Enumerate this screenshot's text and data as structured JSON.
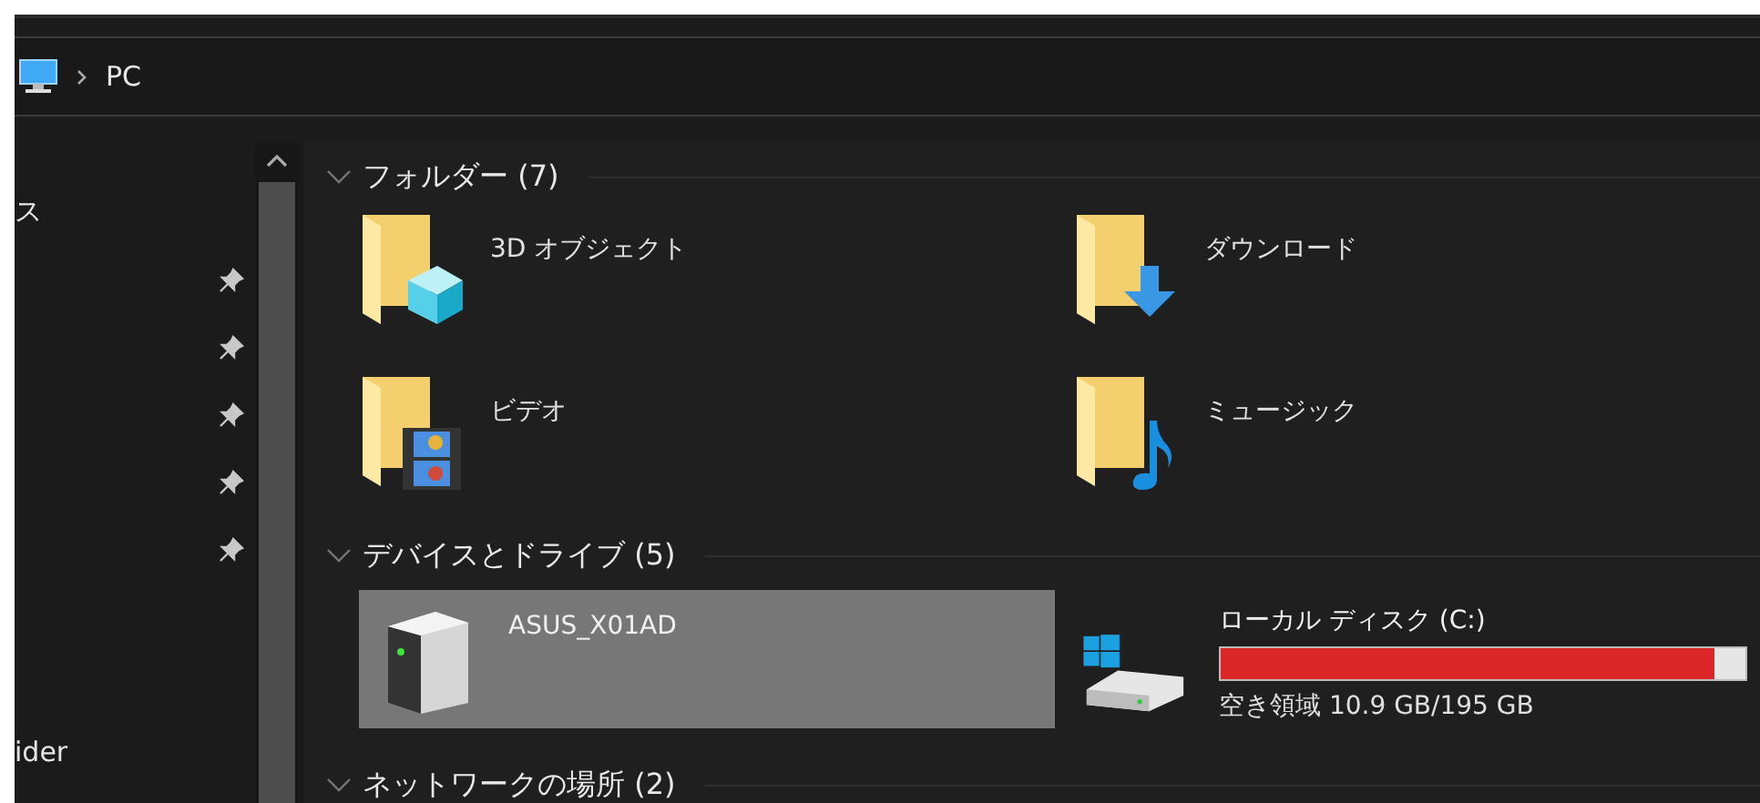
{
  "address_bar": {
    "path": [
      "PC"
    ]
  },
  "sidebar": {
    "items": [
      {
        "label": "ス",
        "pinned": false
      },
      {
        "pinned": true
      },
      {
        "pinned": true
      },
      {
        "pinned": true
      },
      {
        "pinned": true
      },
      {
        "pinned": true
      },
      {
        "label": "ider",
        "pinned": false
      }
    ]
  },
  "groups": [
    {
      "title": "フォルダー (7)",
      "expanded": true,
      "kind": "folders",
      "items": [
        {
          "name": "3D オブジェクト",
          "selected": false
        },
        {
          "name": "ダウンロード",
          "selected": false
        },
        {
          "name": "ビデオ",
          "selected": false
        },
        {
          "name": "ミュージック",
          "selected": false
        }
      ]
    },
    {
      "title": "デバイスとドライブ (5)",
      "expanded": true,
      "kind": "drives",
      "items": [
        {
          "kind": "device",
          "name": "ASUS_X01AD",
          "selected": true
        },
        {
          "kind": "drive",
          "name": "ローカル ディスク (C:)",
          "selected": false,
          "level": 0.94,
          "free": "空き領域 10.9 GB/195 GB"
        }
      ]
    },
    {
      "title": "ネットワークの場所 (2)",
      "expanded": true,
      "kind": "network"
    }
  ]
}
